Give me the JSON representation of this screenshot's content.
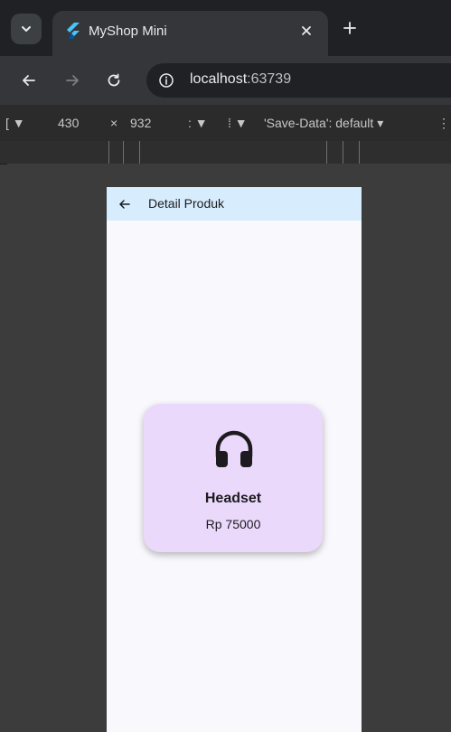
{
  "browser": {
    "tab": {
      "title": "MyShop Mini"
    },
    "address": {
      "host": "localhost",
      "port": ":63739"
    }
  },
  "devtools": {
    "width": "430",
    "times": "×",
    "height": "932",
    "save_data": "'Save-Data': default"
  },
  "app": {
    "appbar_title": "Detail Produk",
    "product": {
      "name": "Headset",
      "price": "Rp 75000",
      "icon": "headset-icon"
    }
  },
  "colors": {
    "appbar": "#d7ecfd",
    "card": "#ead9fb",
    "page": "#f9f9fd"
  }
}
